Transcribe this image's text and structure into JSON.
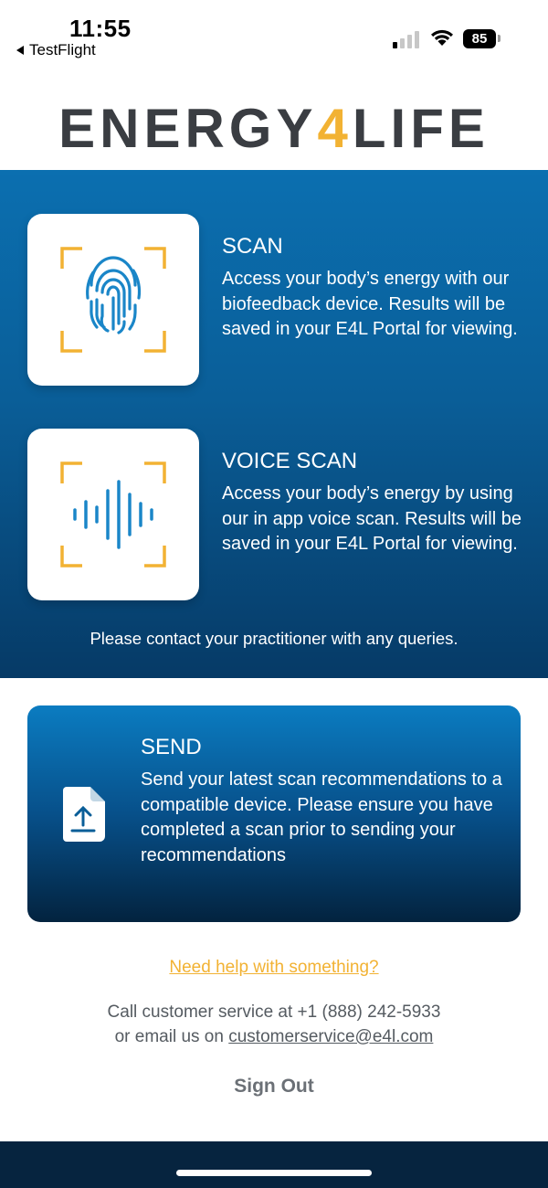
{
  "status_bar": {
    "time": "11:55",
    "back_app": "TestFlight",
    "battery": "85",
    "signal_icon": "cellular-signal-icon",
    "wifi_icon": "wifi-icon"
  },
  "logo": {
    "part1": "ENERGY",
    "accent": "4",
    "part2": "LIFE",
    "accent_color": "#f2b233"
  },
  "features": [
    {
      "title": "SCAN",
      "description": "Access your body’s energy with our biofeedback device. Results will be saved in your E4L Portal for viewing.",
      "icon": "fingerprint-icon"
    },
    {
      "title": "VOICE SCAN",
      "description": "Access your body’s energy by using our in app voice scan. Results will be saved in your E4L Portal for viewing.",
      "icon": "soundwave-icon"
    }
  ],
  "contact_note": "Please contact your practitioner with any queries.",
  "send": {
    "title": "SEND",
    "description": "Send your latest scan recommendations to a compatible device. Please ensure you have completed a scan prior to sending your recommendations",
    "icon": "file-upload-icon"
  },
  "help": {
    "link": "Need help with something?",
    "call_line": "Call customer service at +1 (888) 242-5933",
    "email_prefix": "or email us on ",
    "email": "customerservice@e4l.com"
  },
  "sign_out": "Sign Out",
  "colors": {
    "brand_blue": "#0b6fb0",
    "dark_navy": "#06243f",
    "accent_yellow": "#f2b233"
  }
}
